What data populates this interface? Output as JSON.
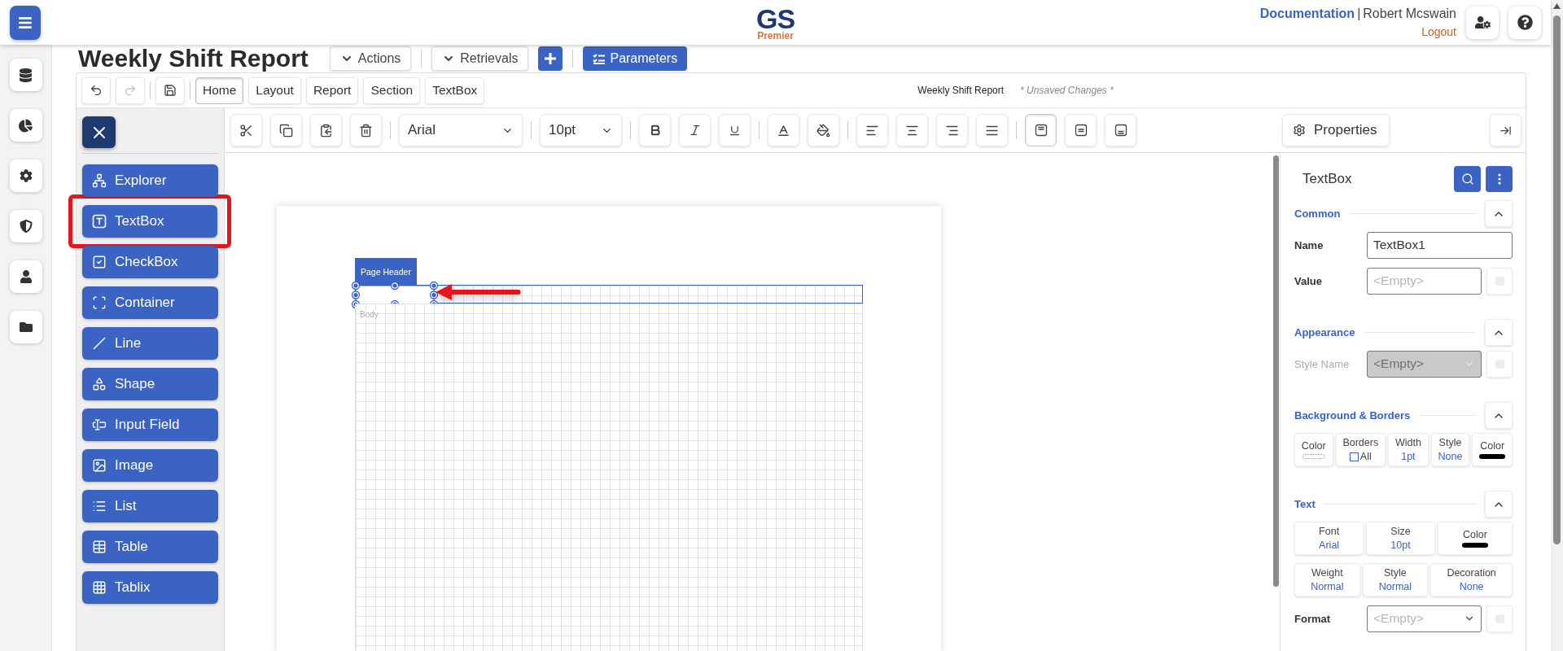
{
  "app": {
    "logo": {
      "initials": "GS",
      "tagline": "Premier"
    },
    "documentation_link": "Documentation",
    "separator": "|",
    "user": "Robert Mcswain",
    "logout": "Logout"
  },
  "report": {
    "title": "Weekly Shift Report",
    "buttons": [
      {
        "kind": "dropdown",
        "label": "Actions"
      },
      {
        "kind": "dropdown",
        "label": "Retrievals"
      },
      {
        "kind": "add"
      },
      {
        "kind": "primary",
        "label": "Parameters"
      }
    ]
  },
  "designer": {
    "redo_disabled": true,
    "tabs": [
      {
        "label": "Home",
        "selected": true
      },
      {
        "label": "Layout",
        "selected": false
      },
      {
        "label": "Report",
        "selected": false
      },
      {
        "label": "Section",
        "selected": false
      },
      {
        "label": "TextBox",
        "selected": false
      }
    ],
    "document_name": "Weekly Shift Report",
    "status": "* Unsaved Changes *"
  },
  "toolbar": {
    "font": "Arial",
    "size": "10pt",
    "vertical_align": [
      {
        "selected": true
      },
      {
        "selected": false
      },
      {
        "selected": false
      }
    ],
    "properties_button": "Properties"
  },
  "palette": {
    "items": [
      {
        "kind": "explorer",
        "label": "Explorer",
        "highlighted": false
      },
      {
        "kind": "textbox",
        "label": "TextBox",
        "highlighted": true
      },
      {
        "kind": "checkbox",
        "label": "CheckBox",
        "highlighted": false
      },
      {
        "kind": "container",
        "label": "Container",
        "highlighted": false
      },
      {
        "kind": "line",
        "label": "Line",
        "highlighted": false
      },
      {
        "kind": "shape",
        "label": "Shape",
        "highlighted": false
      },
      {
        "kind": "input",
        "label": "Input Field",
        "highlighted": false
      },
      {
        "kind": "image",
        "label": "Image",
        "highlighted": false
      },
      {
        "kind": "list",
        "label": "List",
        "highlighted": false
      },
      {
        "kind": "table",
        "label": "Table",
        "highlighted": false
      },
      {
        "kind": "tablix",
        "label": "Tablix",
        "highlighted": false
      }
    ]
  },
  "canvas": {
    "section_tab": "Page Header",
    "body_label": "Body"
  },
  "properties": {
    "title": "TextBox",
    "sections": [
      {
        "title": "Common",
        "expanded": true,
        "rows": [
          {
            "kind": "input",
            "label": "Name",
            "value": "TextBox1",
            "reset_button": false
          },
          {
            "kind": "input",
            "label": "Value",
            "placeholder": "<Empty>",
            "reset_button": true
          }
        ]
      },
      {
        "title": "Appearance",
        "expanded": true,
        "rows": [
          {
            "kind": "select",
            "label": "Style Name",
            "placeholder": "<Empty>",
            "disabled": true,
            "reset_button": true
          }
        ]
      },
      {
        "title": "Background & Borders",
        "expanded": true,
        "rows": [
          {
            "kind": "tiles",
            "tiles": [
              {
                "kind": "empty_swatch",
                "label": "Color"
              },
              {
                "kind": "check",
                "label": "Borders",
                "text": "All",
                "checked": false
              },
              {
                "kind": "value",
                "label": "Width",
                "value": "1pt"
              },
              {
                "kind": "value",
                "label": "Style",
                "value": "None"
              },
              {
                "kind": "swatch",
                "label": "Color",
                "color": "#000000"
              }
            ]
          }
        ]
      },
      {
        "title": "Text",
        "expanded": true,
        "rows": [
          {
            "kind": "tiles",
            "tiles": [
              {
                "kind": "value",
                "label": "Font",
                "value": "Arial"
              },
              {
                "kind": "value",
                "label": "Size",
                "value": "10pt"
              },
              {
                "kind": "swatch",
                "label": "Color",
                "color": "#000000"
              }
            ]
          },
          {
            "kind": "tiles",
            "tiles": [
              {
                "kind": "value",
                "label": "Weight",
                "value": "Normal"
              },
              {
                "kind": "value",
                "label": "Style",
                "value": "Normal"
              },
              {
                "kind": "value",
                "label": "Decoration",
                "value": "None"
              }
            ]
          },
          {
            "kind": "select",
            "label": "Format",
            "placeholder": "<Empty>",
            "disabled": false,
            "reset_button": true
          }
        ]
      }
    ]
  }
}
